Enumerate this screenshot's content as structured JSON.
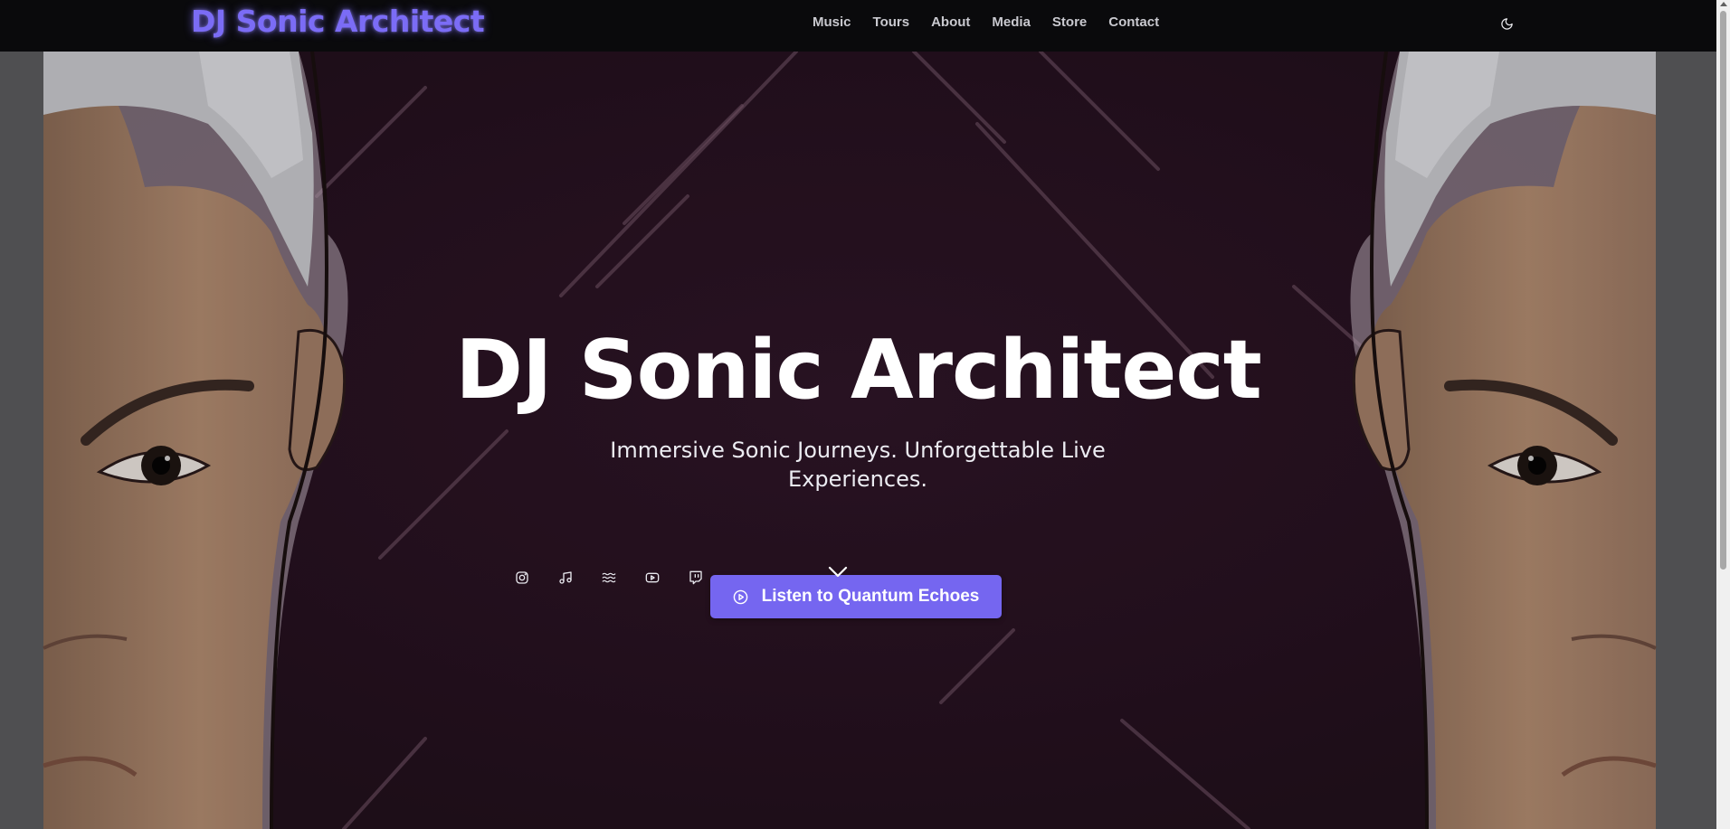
{
  "header": {
    "brand": "DJ Sonic Architect",
    "nav": [
      "Music",
      "Tours",
      "About",
      "Media",
      "Store",
      "Contact"
    ],
    "theme_toggle_icon": "moon-icon"
  },
  "hero": {
    "title": "DJ Sonic Architect",
    "tagline": "Immersive Sonic Journeys. Unforgettable Live Experiences.",
    "social_icons": [
      "instagram-icon",
      "music-note-icon",
      "waves-icon",
      "youtube-icon",
      "twitch-icon"
    ],
    "scroll_icon": "chevron-down-icon",
    "cta": {
      "label": "Listen to Quantum Echoes",
      "icon": "play-circle-icon"
    }
  },
  "colors": {
    "accent": "#7566f0",
    "brand_glow": "#7b6cf6",
    "header_bg": "#0a0a0c",
    "hero_bg": "#2a1322"
  }
}
